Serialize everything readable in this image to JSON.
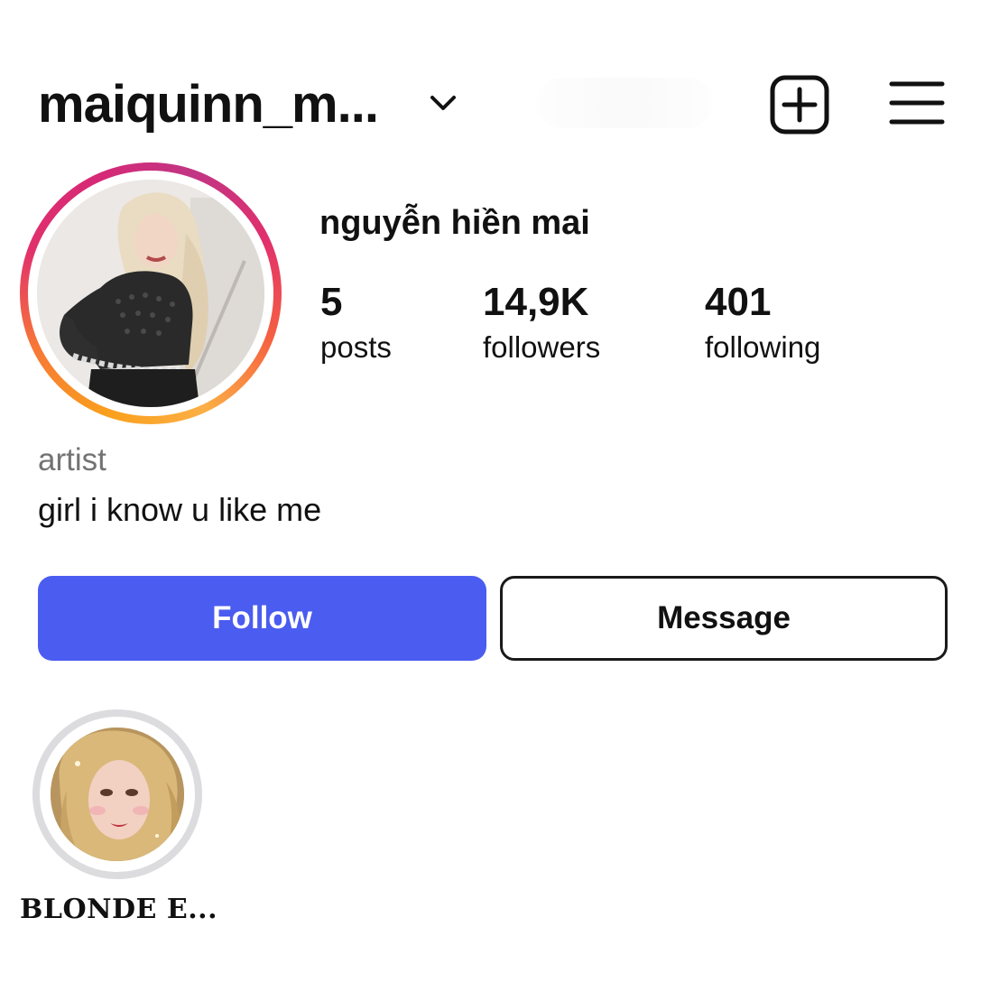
{
  "header": {
    "username": "maiquinn_m...",
    "chevron_icon": "chevron-down-icon",
    "new_post_icon": "plus-square-icon",
    "menu_icon": "hamburger-menu-icon"
  },
  "profile": {
    "display_name": "nguyễn hiền mai",
    "stats": {
      "posts": {
        "value": "5",
        "label": "posts"
      },
      "followers": {
        "value": "14,9K",
        "label": "followers"
      },
      "following": {
        "value": "401",
        "label": "following"
      }
    },
    "category": "artist",
    "bio": "girl i know u like me"
  },
  "actions": {
    "follow_label": "Follow",
    "message_label": "Message"
  },
  "highlights": [
    {
      "label": "BLONDE E..."
    }
  ],
  "colors": {
    "follow_button": "#4b5cf0",
    "category_text": "#737373",
    "story_ring_gradient": [
      "#f9a01c",
      "#e1306c",
      "#c13584"
    ],
    "highlight_ring": "#dcdcdf"
  }
}
